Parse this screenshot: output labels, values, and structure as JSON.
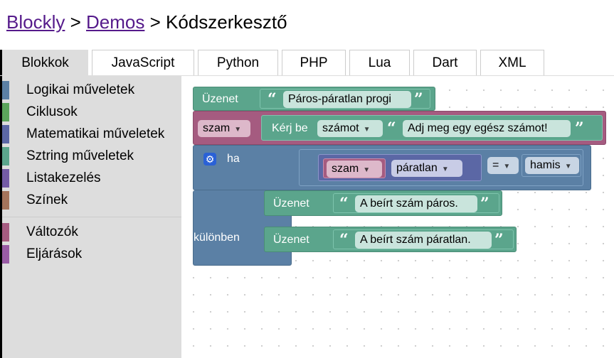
{
  "breadcrumb": {
    "root": "Blockly",
    "sep1": ">",
    "demos": "Demos",
    "sep2": ">",
    "current": "Kódszerkesztő"
  },
  "tabs": [
    "Blokkok",
    "JavaScript",
    "Python",
    "PHP",
    "Lua",
    "Dart",
    "XML"
  ],
  "toolbox": {
    "categories": [
      {
        "label": "Logikai műveletek",
        "color": "#5b80a5"
      },
      {
        "label": "Ciklusok",
        "color": "#5ba55b"
      },
      {
        "label": "Matematikai műveletek",
        "color": "#5b67a5"
      },
      {
        "label": "Sztring műveletek",
        "color": "#5ba58c"
      },
      {
        "label": "Listakezelés",
        "color": "#745ba5"
      },
      {
        "label": "Színek",
        "color": "#a5745b"
      }
    ],
    "categories2": [
      {
        "label": "Változók",
        "color": "#a55b80"
      },
      {
        "label": "Eljárások",
        "color": "#995ba5"
      }
    ]
  },
  "blocks": {
    "print1": {
      "label": "Üzenet",
      "text": "Páros-páratlan progi"
    },
    "set_var": {
      "var": "szam",
      "prompt_label": "Kérj be",
      "prompt_type": "számot",
      "prompt_text": "Adj meg egy egész számot!"
    },
    "if": {
      "label": "ha",
      "else_label": "különben"
    },
    "compare": {
      "var": "szam",
      "property": "páratlan",
      "op": "=",
      "value": "hamis"
    },
    "print2": {
      "label": "Üzenet",
      "text": "A beírt szám páros."
    },
    "print3": {
      "label": "Üzenet",
      "text": "A beírt szám páratlan."
    },
    "quote_open": "“",
    "quote_close": "”"
  },
  "colors": {
    "logic": "#5b80a5",
    "text": "#5ba58c",
    "variable": "#a55b80",
    "math": "#5b67a5"
  }
}
